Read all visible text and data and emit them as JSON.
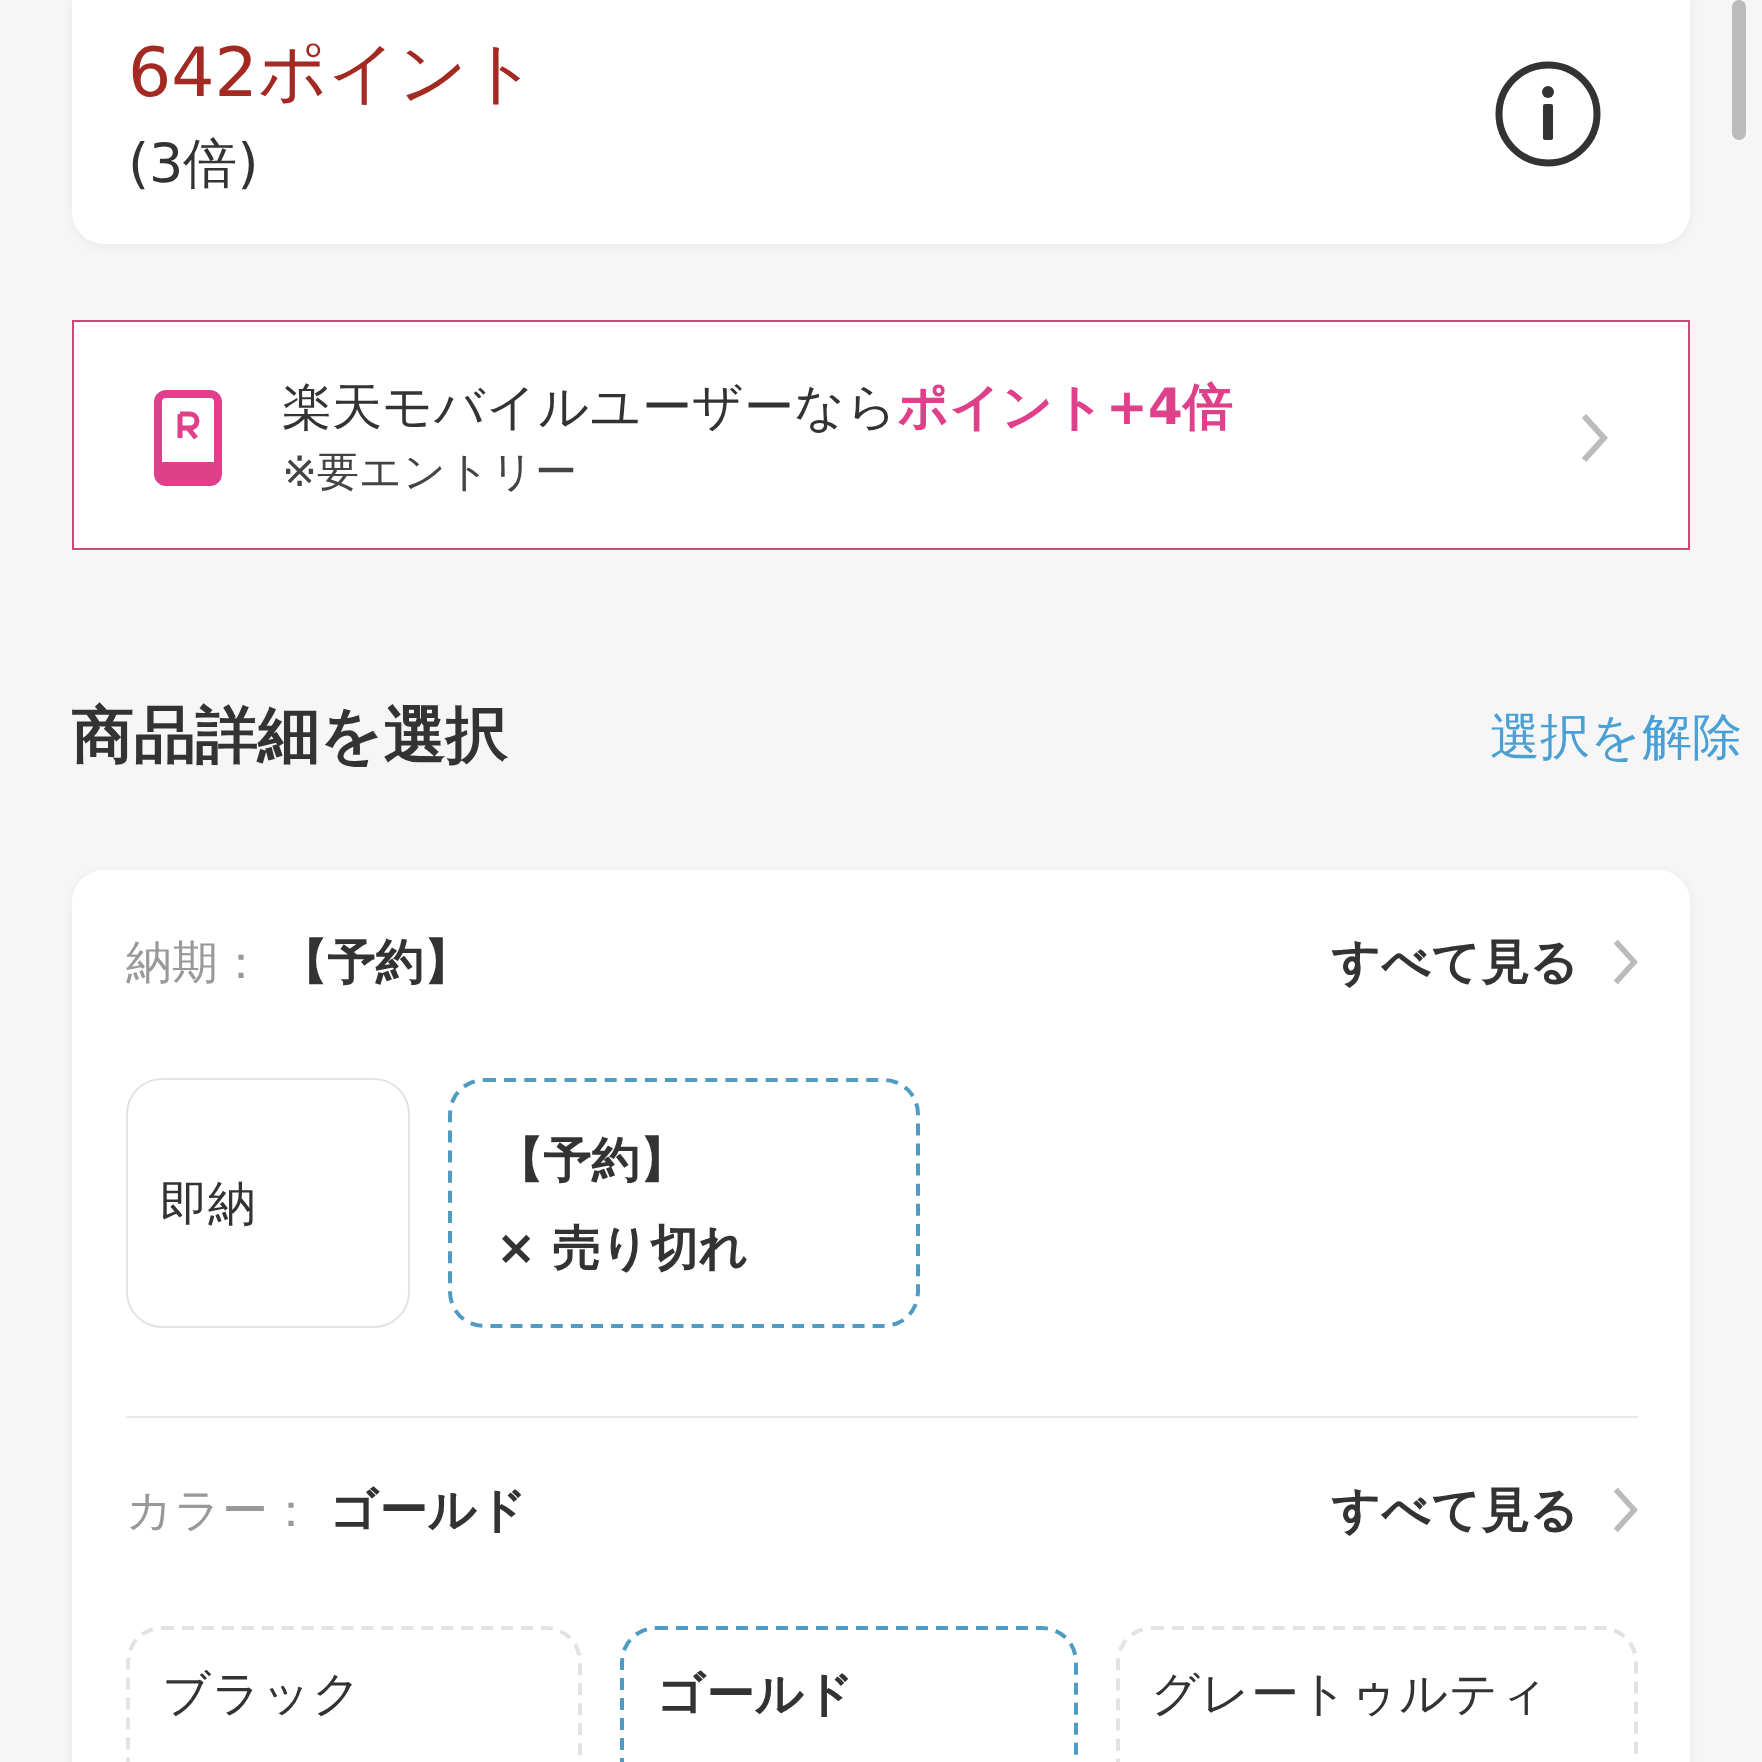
{
  "points": {
    "amount": "642ポイント",
    "multiplier": "(3倍)"
  },
  "mobile_banner": {
    "text": "楽天モバイルユーザーなら**ポイント+4倍**",
    "note": "※要エントリー"
  },
  "section": {
    "title": "商品詳細を選択",
    "clear_link": "選択を解除"
  },
  "option_groups": [
    {
      "label": "納期：",
      "value": "【予約】",
      "see_all": "すべて見る",
      "options": [
        {
          "name": "即納",
          "selected": false,
          "sold_out": false
        },
        {
          "name": "【予約】",
          "status": "× 売り切れ",
          "selected": true,
          "sold_out": true
        }
      ]
    },
    {
      "label": "カラー：",
      "value": "ゴールド",
      "see_all": "すべて見る",
      "options": [
        {
          "name": "ブラック",
          "selected": false,
          "sold_out": true
        },
        {
          "name": "ゴールド",
          "selected": true,
          "sold_out": true
        },
        {
          "name": "グレートゥルティ",
          "selected": false,
          "sold_out": true
        }
      ]
    }
  ]
}
